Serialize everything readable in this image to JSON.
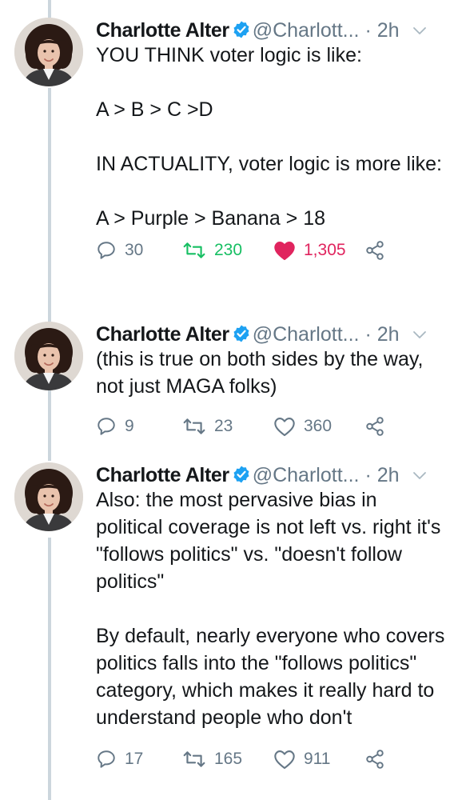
{
  "tweets": [
    {
      "name": "Charlotte Alter",
      "handle": "@Charlott...",
      "dot": "·",
      "time": "2h",
      "text": "YOU THINK voter logic is like:\n\nA > B > C >D\n\nIN ACTUALITY, voter logic is more like:\n\nA > Purple > Banana > 18",
      "replies": "30",
      "retweets": "230",
      "likes": "1,305",
      "retweeted": true,
      "liked": true
    },
    {
      "name": "Charlotte Alter",
      "handle": "@Charlott...",
      "dot": "·",
      "time": "2h",
      "text": "(this is true on both sides by the way, not just MAGA folks)",
      "replies": "9",
      "retweets": "23",
      "likes": "360",
      "retweeted": false,
      "liked": false
    },
    {
      "name": "Charlotte Alter",
      "handle": "@Charlott...",
      "dot": "·",
      "time": "2h",
      "text": "Also: the most pervasive bias in political coverage is not left vs. right it's \"follows politics\" vs. \"doesn't follow politics\"\n\nBy default, nearly everyone who covers politics falls into the \"follows politics\" category, which makes it really hard to understand people who don't",
      "replies": "17",
      "retweets": "165",
      "likes": "911",
      "retweeted": false,
      "liked": false
    }
  ],
  "icons": {
    "verified": "verified-badge-icon",
    "menu": "chevron-down-icon",
    "reply": "reply-icon",
    "retweet": "retweet-icon",
    "like": "heart-icon",
    "share": "share-icon"
  },
  "colors": {
    "text": "#14171a",
    "muted": "#657786",
    "verified": "#1da1f2",
    "retweet_active": "#17bf63",
    "like_active": "#e0245e",
    "thread_line": "#ccd6dd"
  }
}
